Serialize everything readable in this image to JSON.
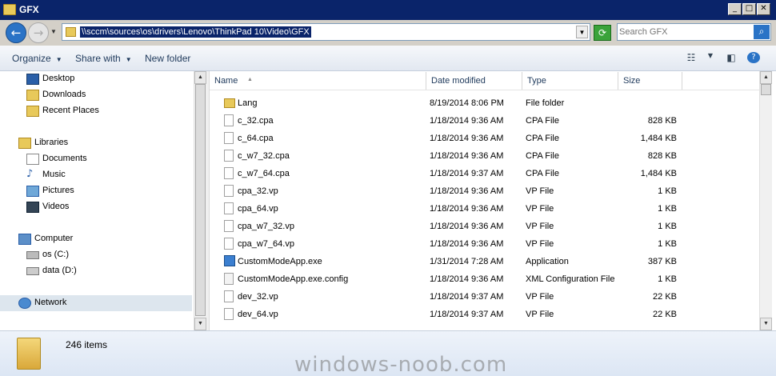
{
  "window": {
    "title": "GFX"
  },
  "address": {
    "path": "\\\\sccm\\sources\\os\\drivers\\Lenovo\\ThinkPad 10\\Video\\GFX",
    "search_placeholder": "Search GFX"
  },
  "toolbar": {
    "organize": "Organize",
    "share_with": "Share with",
    "new_folder": "New folder"
  },
  "nav": {
    "items": [
      {
        "label": "Desktop",
        "icon": "desktop-icon"
      },
      {
        "label": "Downloads",
        "icon": "downloads-icon"
      },
      {
        "label": "Recent Places",
        "icon": "recent-places-icon"
      },
      {
        "label": "Libraries",
        "icon": "libraries-icon"
      },
      {
        "label": "Documents",
        "icon": "documents-icon"
      },
      {
        "label": "Music",
        "icon": "music-icon"
      },
      {
        "label": "Pictures",
        "icon": "pictures-icon"
      },
      {
        "label": "Videos",
        "icon": "videos-icon"
      },
      {
        "label": "Computer",
        "icon": "computer-icon"
      },
      {
        "label": "os (C:)",
        "icon": "drive-icon"
      },
      {
        "label": "data (D:)",
        "icon": "drive-icon"
      },
      {
        "label": "Network",
        "icon": "network-icon"
      }
    ]
  },
  "columns": {
    "name": "Name",
    "date": "Date modified",
    "type": "Type",
    "size": "Size"
  },
  "files": [
    {
      "name": "Lang",
      "date": "8/19/2014 8:06 PM",
      "type": "File folder",
      "size": "",
      "icon": "folder-icon"
    },
    {
      "name": "c_32.cpa",
      "date": "1/18/2014 9:36 AM",
      "type": "CPA File",
      "size": "828 KB",
      "icon": "file-icon"
    },
    {
      "name": "c_64.cpa",
      "date": "1/18/2014 9:36 AM",
      "type": "CPA File",
      "size": "1,484 KB",
      "icon": "file-icon"
    },
    {
      "name": "c_w7_32.cpa",
      "date": "1/18/2014 9:36 AM",
      "type": "CPA File",
      "size": "828 KB",
      "icon": "file-icon"
    },
    {
      "name": "c_w7_64.cpa",
      "date": "1/18/2014 9:37 AM",
      "type": "CPA File",
      "size": "1,484 KB",
      "icon": "file-icon"
    },
    {
      "name": "cpa_32.vp",
      "date": "1/18/2014 9:36 AM",
      "type": "VP File",
      "size": "1 KB",
      "icon": "file-icon"
    },
    {
      "name": "cpa_64.vp",
      "date": "1/18/2014 9:36 AM",
      "type": "VP File",
      "size": "1 KB",
      "icon": "file-icon"
    },
    {
      "name": "cpa_w7_32.vp",
      "date": "1/18/2014 9:36 AM",
      "type": "VP File",
      "size": "1 KB",
      "icon": "file-icon"
    },
    {
      "name": "cpa_w7_64.vp",
      "date": "1/18/2014 9:36 AM",
      "type": "VP File",
      "size": "1 KB",
      "icon": "file-icon"
    },
    {
      "name": "CustomModeApp.exe",
      "date": "1/31/2014 7:28 AM",
      "type": "Application",
      "size": "387 KB",
      "icon": "application-icon"
    },
    {
      "name": "CustomModeApp.exe.config",
      "date": "1/18/2014 9:36 AM",
      "type": "XML Configuration File",
      "size": "1 KB",
      "icon": "config-file-icon"
    },
    {
      "name": "dev_32.vp",
      "date": "1/18/2014 9:37 AM",
      "type": "VP File",
      "size": "22 KB",
      "icon": "file-icon"
    },
    {
      "name": "dev_64.vp",
      "date": "1/18/2014 9:37 AM",
      "type": "VP File",
      "size": "22 KB",
      "icon": "file-icon"
    }
  ],
  "status": {
    "item_count": "246 items"
  },
  "watermark": "windows-noob.com"
}
